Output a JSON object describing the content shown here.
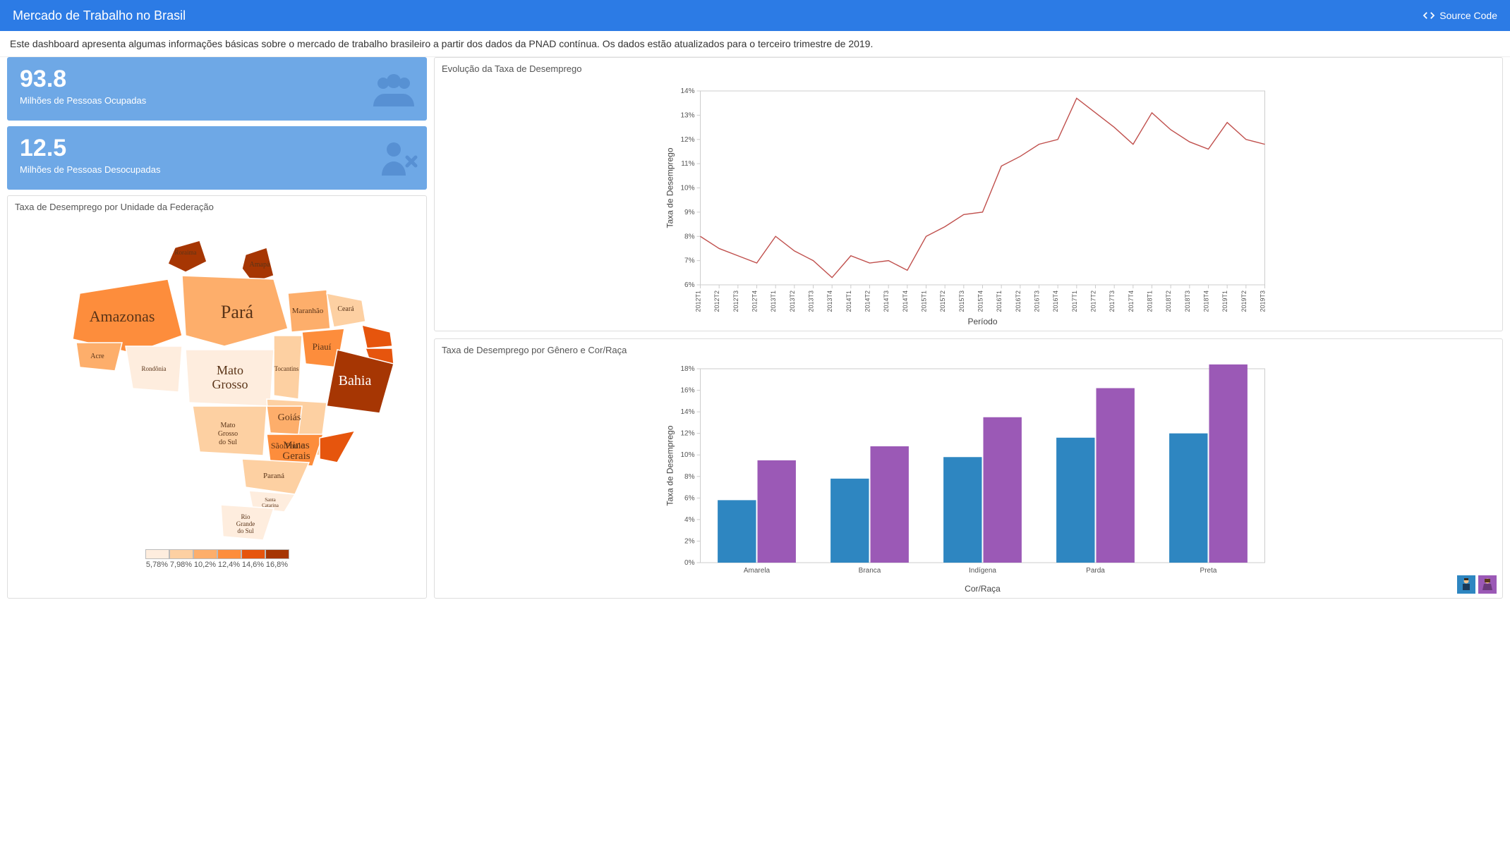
{
  "header": {
    "title": "Mercado de Trabalho no Brasil",
    "source_code": "Source Code"
  },
  "intro": "Este dashboard apresenta algumas informações básicas sobre o mercado de trabalho brasileiro a partir dos dados da PNAD contínua. Os dados estão atualizados para o terceiro trimestre de 2019.",
  "kpi": {
    "occupied_value": "93.8",
    "occupied_label": "Milhões de Pessoas Ocupadas",
    "unemployed_value": "12.5",
    "unemployed_label": "Milhões de Pessoas Desocupadas"
  },
  "map": {
    "title": "Taxa de Desemprego por Unidade da Federação",
    "legend_values": [
      "5,78%",
      "7,98%",
      "10,2%",
      "12,4%",
      "14,6%",
      "16,8%"
    ],
    "legend_colors": [
      "#feedde",
      "#fdd0a2",
      "#fdae6b",
      "#fd8d3c",
      "#e6550d",
      "#a63603"
    ],
    "state_labels": [
      "Roraima",
      "Amapá",
      "Amazonas",
      "Pará",
      "Acre",
      "Rondônia",
      "Maranhão",
      "Ceará",
      "Piauí",
      "Bahia",
      "Tocantins",
      "Mato Grosso",
      "Mato Grosso do Sul",
      "Goiás",
      "Minas Gerais",
      "São Paulo",
      "Paraná",
      "Santa Catarina",
      "Rio Grande do Sul"
    ]
  },
  "chart_line": {
    "title": "Evolução da Taxa de Desemprego",
    "xlabel": "Período",
    "ylabel": "Taxa de Desemprego"
  },
  "chart_bar": {
    "title": "Taxa de Desemprego por Gênero e Cor/Raça",
    "xlabel": "Cor/Raça",
    "ylabel": "Taxa de Desemprego"
  },
  "chart_data": [
    {
      "type": "line",
      "title": "Evolução da Taxa de Desemprego",
      "xlabel": "Período",
      "ylabel": "Taxa de Desemprego",
      "x": [
        "2012T1",
        "2012T2",
        "2012T3",
        "2012T4",
        "2013T1",
        "2013T2",
        "2013T3",
        "2013T4",
        "2014T1",
        "2014T2",
        "2014T3",
        "2014T4",
        "2015T1",
        "2015T2",
        "2015T3",
        "2015T4",
        "2016T1",
        "2016T2",
        "2016T3",
        "2016T4",
        "2017T1",
        "2017T2",
        "2017T3",
        "2017T4",
        "2018T1",
        "2018T2",
        "2018T3",
        "2018T4",
        "2019T1",
        "2019T2",
        "2019T3"
      ],
      "values": [
        8.0,
        7.5,
        7.2,
        6.9,
        8.0,
        7.4,
        7.0,
        6.3,
        7.2,
        6.9,
        7.0,
        6.6,
        8.0,
        8.4,
        8.9,
        9.0,
        10.9,
        11.3,
        11.8,
        12.0,
        13.7,
        13.1,
        12.5,
        11.8,
        13.1,
        12.4,
        11.9,
        11.6,
        12.7,
        12.0,
        11.8
      ],
      "ylim": [
        6,
        14
      ],
      "y_ticks": [
        6,
        7,
        8,
        9,
        10,
        11,
        12,
        13,
        14
      ],
      "y_format": "%"
    },
    {
      "type": "bar",
      "title": "Taxa de Desemprego por Gênero e Cor/Raça",
      "xlabel": "Cor/Raça",
      "ylabel": "Taxa de Desemprego",
      "categories": [
        "Amarela",
        "Branca",
        "Indígena",
        "Parda",
        "Preta"
      ],
      "series": [
        {
          "name": "Homem",
          "values": [
            5.8,
            7.8,
            9.8,
            11.6,
            12.0
          ],
          "color": "#2E86C1"
        },
        {
          "name": "Mulher",
          "values": [
            9.5,
            10.8,
            13.5,
            16.2,
            18.4
          ],
          "color": "#9B59B6"
        }
      ],
      "ylim": [
        0,
        18
      ],
      "y_ticks": [
        0,
        2,
        4,
        6,
        8,
        10,
        12,
        14,
        16,
        18
      ],
      "y_format": "%"
    }
  ]
}
